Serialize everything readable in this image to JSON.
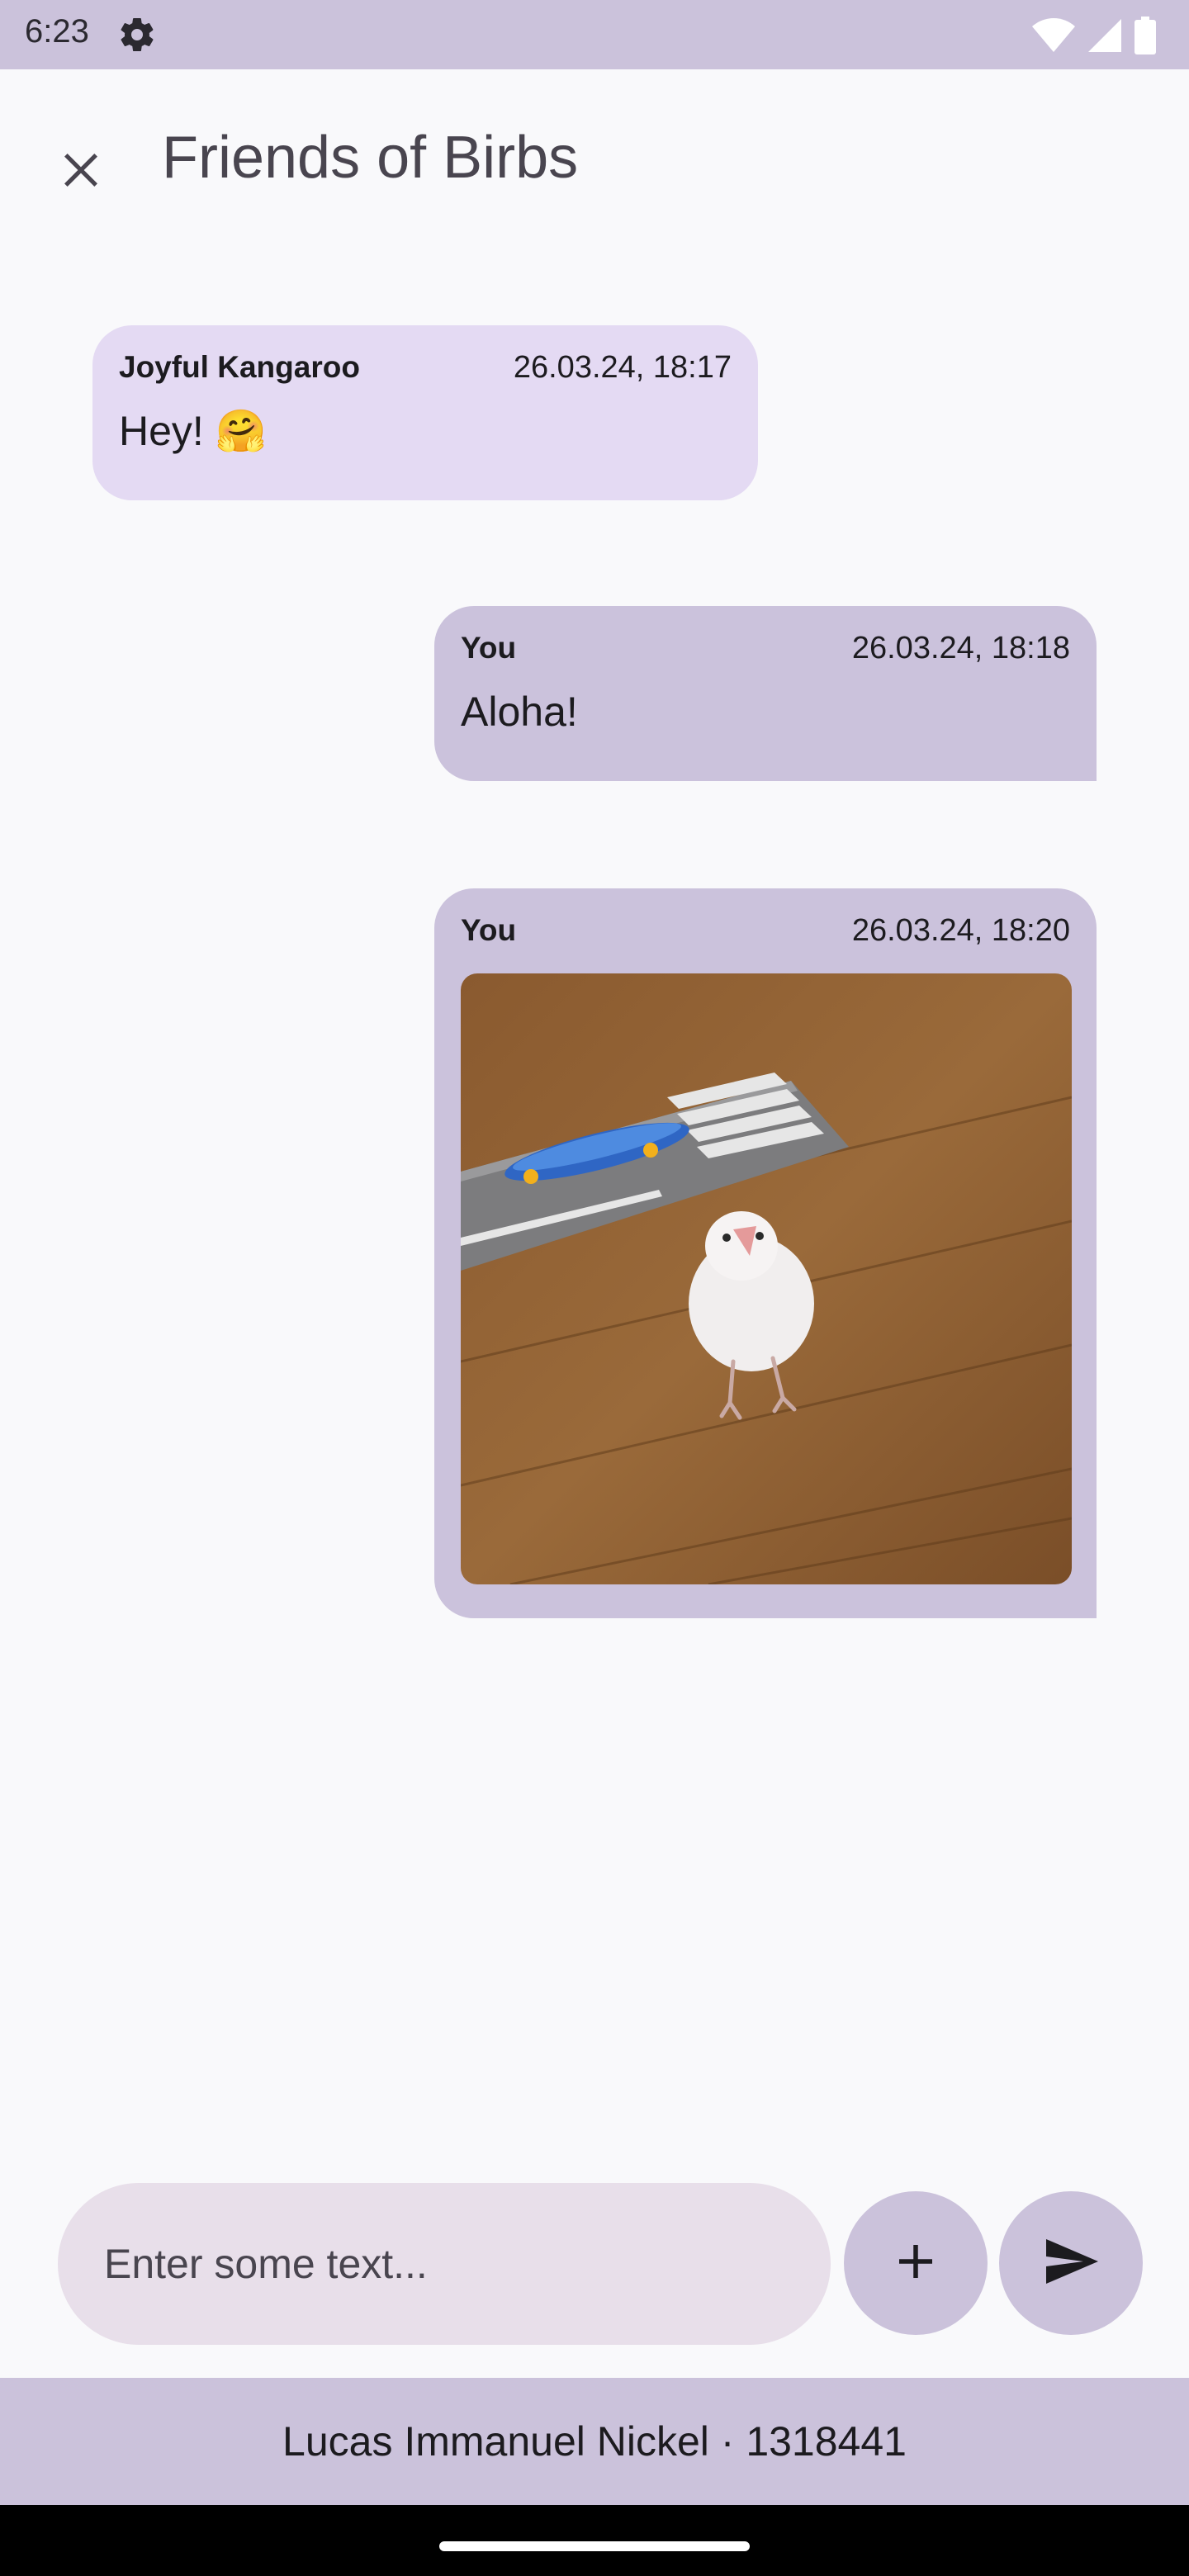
{
  "status": {
    "time": "6:23"
  },
  "header": {
    "title": "Friends of Birbs"
  },
  "messages": [
    {
      "sender": "Joyful Kangaroo",
      "timestamp": "26.03.24, 18:17",
      "text": "Hey! 🤗"
    },
    {
      "sender": "You",
      "timestamp": "26.03.24, 18:18",
      "text": "Aloha!"
    },
    {
      "sender": "You",
      "timestamp": "26.03.24, 18:20",
      "image": "bird-with-skateboard-photo"
    }
  ],
  "composer": {
    "placeholder": "Enter some text...",
    "value": ""
  },
  "footer": {
    "text": "Lucas Immanuel Nickel · 1318441"
  },
  "colors": {
    "status_bar": "#cbc2db",
    "bubble_other": "#e4daf3",
    "bubble_mine": "#cbc2dc",
    "input_bg": "#e8dfea",
    "background": "#f9f9fb"
  },
  "icons": {
    "status_left": "gear-icon",
    "status_right": [
      "wifi-icon",
      "signal-icon",
      "battery-icon"
    ],
    "appbar": "close-icon",
    "composer": [
      "add-icon",
      "send-icon"
    ]
  }
}
